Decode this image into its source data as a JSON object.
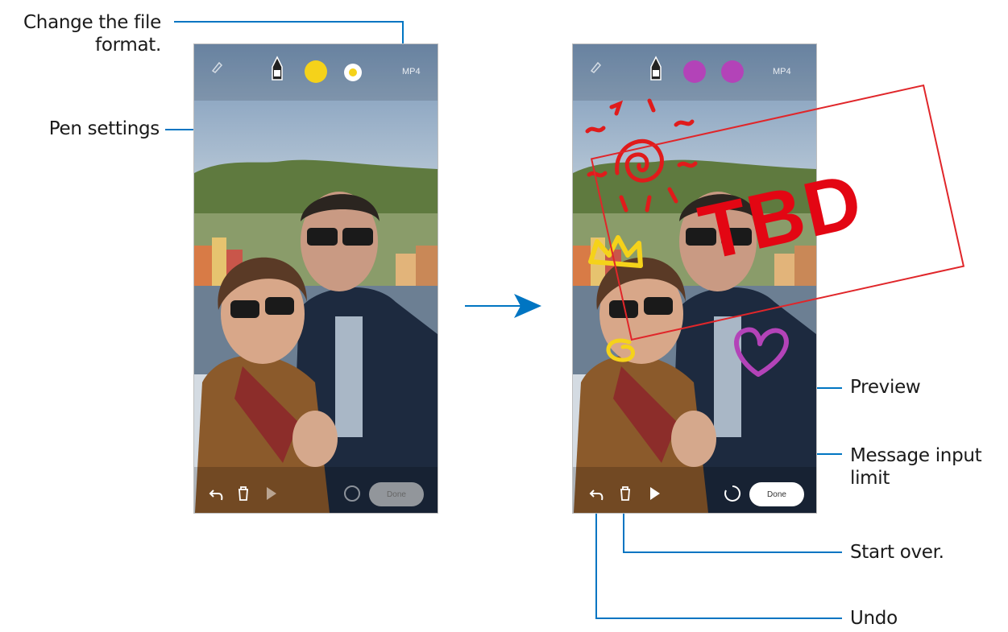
{
  "callouts": {
    "file_format": "Change the file\nformat.",
    "pen_settings": "Pen settings",
    "preview": "Preview",
    "message_limit": "Message input\nlimit",
    "start_over": "Start over.",
    "undo": "Undo"
  },
  "left_phone": {
    "format_label": "MP4",
    "done_label": "Done",
    "swatch_colors": [
      "#f5d21a",
      "#f3e0a0"
    ]
  },
  "right_phone": {
    "format_label": "MP4",
    "done_label": "Done",
    "swatch_colors": [
      "#b343b8",
      "#b343b8"
    ]
  },
  "stamp": {
    "text": "TBD",
    "color": "#e30613"
  },
  "colors": {
    "leader": "#0075c2",
    "highlight": "#0075c2"
  }
}
